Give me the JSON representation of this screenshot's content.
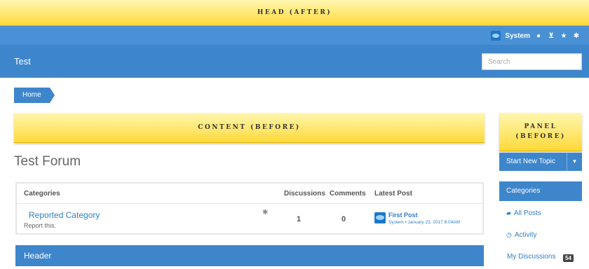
{
  "assets": {
    "head_after": "Head (after)",
    "content_before": "Content (before)",
    "panel_before": "Panel (before)"
  },
  "meta": {
    "user_name": "System",
    "icons": [
      "globe-icon",
      "inbox-icon",
      "star-icon",
      "gear-icon"
    ]
  },
  "site": {
    "title": "Test",
    "search_placeholder": "Search"
  },
  "breadcrumb": {
    "home": "Home"
  },
  "forum": {
    "title": "Test Forum"
  },
  "categories_table": {
    "headers": {
      "categories": "Categories",
      "discussions": "Discussions",
      "comments": "Comments",
      "latest_post": "Latest Post"
    },
    "rows": [
      {
        "name": "Reported Category",
        "description": "Report this.",
        "discussions": "1",
        "comments": "0",
        "latest_post_title": "First Post",
        "latest_post_meta": "System • January 23, 2017 8:04AM"
      }
    ]
  },
  "header_section": {
    "label": "Header"
  },
  "panel": {
    "start_topic": "Start New Topic",
    "caret": "▼",
    "categories": "Categories",
    "all_posts": "All Posts",
    "activity": "Activity",
    "my_discussions": "My Discussions",
    "my_discussions_count": "54"
  },
  "colors": {
    "primary": "#3e86cc",
    "meta_bar": "#4a90d4",
    "asset_yellow": "#ffd93a",
    "link": "#2f7fc5"
  }
}
